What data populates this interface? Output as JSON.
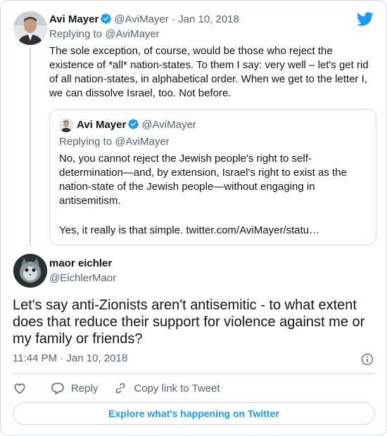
{
  "parent_tweet": {
    "name": "Avi Mayer",
    "handle": "@AviMayer",
    "separator": "·",
    "date": "Jan 10, 2018",
    "replying_to": "Replying to @AviMayer",
    "text": "The sole exception, of course, would be those who reject the existence of *all* nation-states. To them I say: very well – let's get rid of all nation-states, in alphabetical order. When we get to the letter I, we can dissolve Israel, too. Not before."
  },
  "quoted_tweet": {
    "name": "Avi Mayer",
    "handle": "@AviMayer",
    "replying_to": "Replying to @AviMayer",
    "text": "No, you cannot reject the Jewish people's right to self-determination—and, by extension, Israel's right to exist as the nation-state of the Jewish people—without engaging in antisemitism.",
    "text2": "Yes, it really is that simple. twitter.com/AviMayer/statu…"
  },
  "main_tweet": {
    "name": "maor eichler",
    "handle": "@EichlerMaor",
    "text": "Let's say anti-Zionists aren't antisemitic - to what extent does that reduce their support for violence against me or my family or friends?",
    "timestamp": "11:44 PM · Jan 10, 2018"
  },
  "actions": {
    "reply": "Reply",
    "copy_link": "Copy link to Tweet"
  },
  "explore_label": "Explore what's happening on Twitter",
  "icons": {
    "logo": "twitter-bird-icon",
    "verified": "verified-badge-icon",
    "info": "info-icon",
    "like": "heart-icon",
    "reply": "reply-bubble-icon",
    "link": "link-icon"
  },
  "colors": {
    "brand": "#1d9bf0",
    "text": "#0f1419",
    "muted": "#536471",
    "border": "#cfd9de"
  }
}
